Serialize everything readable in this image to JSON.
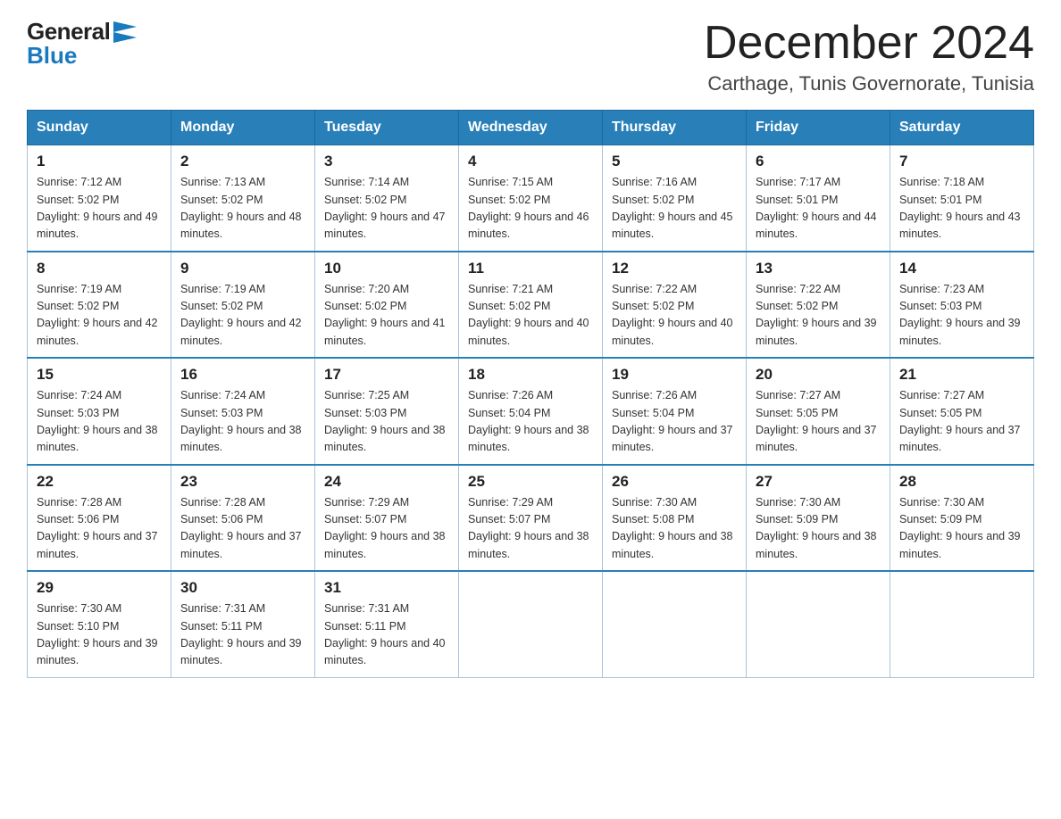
{
  "logo": {
    "general": "General",
    "blue": "Blue"
  },
  "title": "December 2024",
  "location": "Carthage, Tunis Governorate, Tunisia",
  "days_of_week": [
    "Sunday",
    "Monday",
    "Tuesday",
    "Wednesday",
    "Thursday",
    "Friday",
    "Saturday"
  ],
  "weeks": [
    [
      {
        "day": "1",
        "sunrise": "7:12 AM",
        "sunset": "5:02 PM",
        "daylight": "9 hours and 49 minutes."
      },
      {
        "day": "2",
        "sunrise": "7:13 AM",
        "sunset": "5:02 PM",
        "daylight": "9 hours and 48 minutes."
      },
      {
        "day": "3",
        "sunrise": "7:14 AM",
        "sunset": "5:02 PM",
        "daylight": "9 hours and 47 minutes."
      },
      {
        "day": "4",
        "sunrise": "7:15 AM",
        "sunset": "5:02 PM",
        "daylight": "9 hours and 46 minutes."
      },
      {
        "day": "5",
        "sunrise": "7:16 AM",
        "sunset": "5:02 PM",
        "daylight": "9 hours and 45 minutes."
      },
      {
        "day": "6",
        "sunrise": "7:17 AM",
        "sunset": "5:01 PM",
        "daylight": "9 hours and 44 minutes."
      },
      {
        "day": "7",
        "sunrise": "7:18 AM",
        "sunset": "5:01 PM",
        "daylight": "9 hours and 43 minutes."
      }
    ],
    [
      {
        "day": "8",
        "sunrise": "7:19 AM",
        "sunset": "5:02 PM",
        "daylight": "9 hours and 42 minutes."
      },
      {
        "day": "9",
        "sunrise": "7:19 AM",
        "sunset": "5:02 PM",
        "daylight": "9 hours and 42 minutes."
      },
      {
        "day": "10",
        "sunrise": "7:20 AM",
        "sunset": "5:02 PM",
        "daylight": "9 hours and 41 minutes."
      },
      {
        "day": "11",
        "sunrise": "7:21 AM",
        "sunset": "5:02 PM",
        "daylight": "9 hours and 40 minutes."
      },
      {
        "day": "12",
        "sunrise": "7:22 AM",
        "sunset": "5:02 PM",
        "daylight": "9 hours and 40 minutes."
      },
      {
        "day": "13",
        "sunrise": "7:22 AM",
        "sunset": "5:02 PM",
        "daylight": "9 hours and 39 minutes."
      },
      {
        "day": "14",
        "sunrise": "7:23 AM",
        "sunset": "5:03 PM",
        "daylight": "9 hours and 39 minutes."
      }
    ],
    [
      {
        "day": "15",
        "sunrise": "7:24 AM",
        "sunset": "5:03 PM",
        "daylight": "9 hours and 38 minutes."
      },
      {
        "day": "16",
        "sunrise": "7:24 AM",
        "sunset": "5:03 PM",
        "daylight": "9 hours and 38 minutes."
      },
      {
        "day": "17",
        "sunrise": "7:25 AM",
        "sunset": "5:03 PM",
        "daylight": "9 hours and 38 minutes."
      },
      {
        "day": "18",
        "sunrise": "7:26 AM",
        "sunset": "5:04 PM",
        "daylight": "9 hours and 38 minutes."
      },
      {
        "day": "19",
        "sunrise": "7:26 AM",
        "sunset": "5:04 PM",
        "daylight": "9 hours and 37 minutes."
      },
      {
        "day": "20",
        "sunrise": "7:27 AM",
        "sunset": "5:05 PM",
        "daylight": "9 hours and 37 minutes."
      },
      {
        "day": "21",
        "sunrise": "7:27 AM",
        "sunset": "5:05 PM",
        "daylight": "9 hours and 37 minutes."
      }
    ],
    [
      {
        "day": "22",
        "sunrise": "7:28 AM",
        "sunset": "5:06 PM",
        "daylight": "9 hours and 37 minutes."
      },
      {
        "day": "23",
        "sunrise": "7:28 AM",
        "sunset": "5:06 PM",
        "daylight": "9 hours and 37 minutes."
      },
      {
        "day": "24",
        "sunrise": "7:29 AM",
        "sunset": "5:07 PM",
        "daylight": "9 hours and 38 minutes."
      },
      {
        "day": "25",
        "sunrise": "7:29 AM",
        "sunset": "5:07 PM",
        "daylight": "9 hours and 38 minutes."
      },
      {
        "day": "26",
        "sunrise": "7:30 AM",
        "sunset": "5:08 PM",
        "daylight": "9 hours and 38 minutes."
      },
      {
        "day": "27",
        "sunrise": "7:30 AM",
        "sunset": "5:09 PM",
        "daylight": "9 hours and 38 minutes."
      },
      {
        "day": "28",
        "sunrise": "7:30 AM",
        "sunset": "5:09 PM",
        "daylight": "9 hours and 39 minutes."
      }
    ],
    [
      {
        "day": "29",
        "sunrise": "7:30 AM",
        "sunset": "5:10 PM",
        "daylight": "9 hours and 39 minutes."
      },
      {
        "day": "30",
        "sunrise": "7:31 AM",
        "sunset": "5:11 PM",
        "daylight": "9 hours and 39 minutes."
      },
      {
        "day": "31",
        "sunrise": "7:31 AM",
        "sunset": "5:11 PM",
        "daylight": "9 hours and 40 minutes."
      },
      null,
      null,
      null,
      null
    ]
  ]
}
